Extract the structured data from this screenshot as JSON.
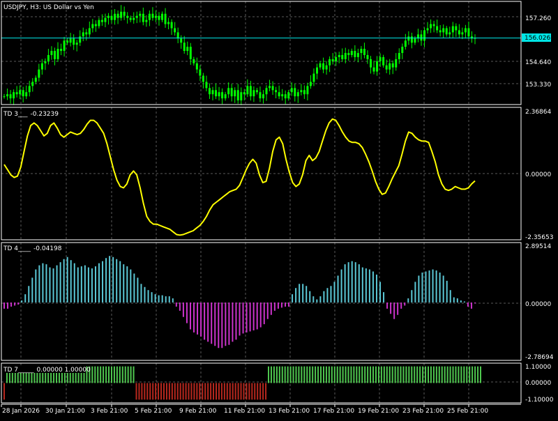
{
  "window": {
    "title": "USDJPY, H3: US Dollar vs Yen"
  },
  "colors": {
    "background": "#000000",
    "grid": "#5a5a5a",
    "frame": "#ffffff",
    "candle": "#00ff00",
    "current_price_line": "#00e5e5",
    "td3_line": "#ffff00",
    "td4_positive": "#5bc8d6",
    "td4_negative": "#cc33cc",
    "td7_positive": "#4fc84f",
    "td7_negative": "#b8281e"
  },
  "panels": {
    "price": {
      "label": "USDJPY, H3: US Dollar vs Yen",
      "current_price": "156.026",
      "axis_labels": [
        "157.260",
        "154.640",
        "153.330"
      ]
    },
    "td3": {
      "label": "TD 3___",
      "value": "-0.23239",
      "axis_labels": [
        "2.36864",
        "0.00000",
        "-2.35653"
      ]
    },
    "td4": {
      "label": "TD 4____",
      "value": "-0.04198",
      "axis_labels": [
        "2.89514",
        "0.00000",
        "-2.78694"
      ]
    },
    "td7": {
      "label": "TD 7_____",
      "value": "0.00000 1.00000",
      "axis_labels": [
        "1.10000",
        "0.00000",
        "-1.10000"
      ]
    }
  },
  "time_axis": {
    "labels": [
      "28 Jan 2026",
      "30 Jan 21:00",
      "3 Feb 21:00",
      "5 Feb 21:00",
      "9 Feb 21:00",
      "11 Feb 21:00",
      "13 Feb 21:00",
      "17 Feb 21:00",
      "19 Feb 21:00",
      "23 Feb 21:00",
      "25 Feb 21:00"
    ]
  },
  "chart_data": [
    {
      "type": "candlestick",
      "title": "USDJPY, H3: US Dollar vs Yen",
      "ylim": [
        152.8,
        157.8
      ],
      "current_price": 156.026,
      "close": [
        153.2,
        153.3,
        153.1,
        153.4,
        153.3,
        153.5,
        153.2,
        153.4,
        153.7,
        153.9,
        154.1,
        154.5,
        154.8,
        154.9,
        155.2,
        155.4,
        155.0,
        155.5,
        155.4,
        155.9,
        155.8,
        156.0,
        155.7,
        155.8,
        156.1,
        156.3,
        156.2,
        156.5,
        156.7,
        156.6,
        156.9,
        156.8,
        157.0,
        157.1,
        156.9,
        157.2,
        157.0,
        157.3,
        157.1,
        157.0,
        156.9,
        157.0,
        157.1,
        157.2,
        156.8,
        156.9,
        157.2,
        157.0,
        157.1,
        156.9,
        157.2,
        156.7,
        156.8,
        156.5,
        156.3,
        156.0,
        155.8,
        155.4,
        155.6,
        155.0,
        154.8,
        154.5,
        154.2,
        153.9,
        153.6,
        153.3,
        153.5,
        153.2,
        153.4,
        153.1,
        153.3,
        153.6,
        153.2,
        153.5,
        153.0,
        153.4,
        153.3,
        153.7,
        153.2,
        153.5,
        153.4,
        153.1,
        153.3,
        153.6,
        153.7,
        153.5,
        153.4,
        153.2,
        153.3,
        153.1,
        153.4,
        153.6,
        153.2,
        153.4,
        153.5,
        153.3,
        153.7,
        153.9,
        154.3,
        154.6,
        154.8,
        154.5,
        154.7,
        155.0,
        154.9,
        155.1,
        155.2,
        155.0,
        155.3,
        155.2,
        155.4,
        155.1,
        155.3,
        155.5,
        155.2,
        155.0,
        154.6,
        154.4,
        154.9,
        155.1,
        154.7,
        154.5,
        154.8,
        154.6,
        155.0,
        155.3,
        155.6,
        155.9,
        156.1,
        155.8,
        156.0,
        156.2,
        155.9,
        156.4,
        156.5,
        156.7,
        156.6,
        156.4,
        156.3,
        156.5,
        156.2,
        156.3,
        156.6,
        156.4,
        156.2,
        156.3,
        156.5,
        156.1,
        156.0,
        156.026
      ],
      "high_offset": 0.28,
      "low_offset": 0.28
    },
    {
      "type": "line",
      "name": "TD 3___",
      "ylim": [
        -2.5,
        2.6
      ],
      "values": [
        0.4,
        0.2,
        0.0,
        -0.1,
        -0.05,
        0.3,
        0.9,
        1.5,
        1.9,
        2.0,
        1.9,
        1.7,
        1.5,
        1.6,
        1.9,
        2.0,
        1.8,
        1.55,
        1.45,
        1.55,
        1.65,
        1.6,
        1.55,
        1.6,
        1.75,
        1.95,
        2.1,
        2.1,
        2.0,
        1.8,
        1.6,
        1.2,
        0.7,
        0.2,
        -0.2,
        -0.45,
        -0.5,
        -0.35,
        0.0,
        0.15,
        0.0,
        -0.5,
        -1.1,
        -1.6,
        -1.8,
        -1.9,
        -1.9,
        -1.95,
        -2.0,
        -2.05,
        -2.1,
        -2.2,
        -2.3,
        -2.32,
        -2.3,
        -2.25,
        -2.2,
        -2.15,
        -2.05,
        -1.95,
        -1.8,
        -1.6,
        -1.35,
        -1.15,
        -1.05,
        -0.95,
        -0.85,
        -0.75,
        -0.65,
        -0.6,
        -0.55,
        -0.4,
        -0.1,
        0.2,
        0.45,
        0.6,
        0.45,
        0.0,
        -0.3,
        -0.25,
        0.25,
        0.9,
        1.35,
        1.45,
        1.2,
        0.6,
        0.1,
        -0.3,
        -0.45,
        -0.35,
        0.0,
        0.55,
        0.75,
        0.55,
        0.65,
        0.9,
        1.3,
        1.7,
        2.0,
        2.15,
        2.1,
        1.9,
        1.65,
        1.45,
        1.3,
        1.25,
        1.25,
        1.2,
        1.05,
        0.8,
        0.5,
        0.15,
        -0.25,
        -0.55,
        -0.75,
        -0.7,
        -0.45,
        -0.15,
        0.1,
        0.35,
        0.8,
        1.3,
        1.65,
        1.6,
        1.45,
        1.35,
        1.3,
        1.3,
        1.25,
        0.9,
        0.5,
        0.0,
        -0.35,
        -0.55,
        -0.6,
        -0.55,
        -0.45,
        -0.5,
        -0.55,
        -0.55,
        -0.5,
        -0.35,
        -0.23239
      ]
    },
    {
      "type": "bar",
      "name": "TD 4____",
      "ylim": [
        -2.8,
        2.9
      ],
      "values": [
        -0.3,
        -0.3,
        -0.2,
        -0.15,
        -0.1,
        0.1,
        0.4,
        0.8,
        1.2,
        1.6,
        1.8,
        1.9,
        1.85,
        1.7,
        1.65,
        1.8,
        1.95,
        2.1,
        2.2,
        2.05,
        1.9,
        1.7,
        1.75,
        1.8,
        1.7,
        1.65,
        1.75,
        1.9,
        2.0,
        2.15,
        2.25,
        2.2,
        2.1,
        2.0,
        1.85,
        1.75,
        1.6,
        1.4,
        1.2,
        0.9,
        0.75,
        0.6,
        0.5,
        0.4,
        0.35,
        0.35,
        0.3,
        0.3,
        0.2,
        -0.2,
        -0.4,
        -0.7,
        -1.0,
        -1.3,
        -1.45,
        -1.55,
        -1.65,
        -1.8,
        -1.9,
        -2.0,
        -2.1,
        -2.2,
        -2.2,
        -2.1,
        -2.05,
        -1.9,
        -1.8,
        -1.6,
        -1.5,
        -1.45,
        -1.4,
        -1.35,
        -1.3,
        -1.2,
        -1.05,
        -0.8,
        -0.6,
        -0.4,
        -0.3,
        -0.25,
        -0.2,
        -0.2,
        0.4,
        0.7,
        0.9,
        0.9,
        0.8,
        0.55,
        0.3,
        0.15,
        0.3,
        0.55,
        0.7,
        0.8,
        1.0,
        1.3,
        1.6,
        1.85,
        1.95,
        2.0,
        1.95,
        1.85,
        1.7,
        1.65,
        1.6,
        1.5,
        1.35,
        1.0,
        0.5,
        -0.3,
        -0.55,
        -0.8,
        -0.6,
        -0.3,
        -0.15,
        0.2,
        0.6,
        1.0,
        1.3,
        1.45,
        1.5,
        1.55,
        1.6,
        1.55,
        1.45,
        1.3,
        1.05,
        0.6,
        0.25,
        0.2,
        0.1,
        0.05,
        -0.2,
        -0.3,
        -0.04198
      ]
    },
    {
      "type": "bar",
      "name": "TD 7_____",
      "ylim": [
        -1.1,
        1.1
      ],
      "values": [
        -1,
        1,
        1,
        1,
        1,
        1,
        1,
        1,
        1,
        1,
        1,
        1,
        1,
        1,
        1,
        1,
        1,
        1,
        1,
        1,
        1,
        1,
        1,
        1,
        1,
        1,
        1,
        1,
        1,
        1,
        1,
        1,
        1,
        1,
        1,
        1,
        1,
        1,
        1,
        1,
        1,
        1,
        1,
        1,
        1,
        1,
        1,
        1,
        -1,
        -1,
        -1,
        -1,
        -1,
        -1,
        -1,
        -1,
        -1,
        -1,
        -1,
        -1,
        -1,
        -1,
        -1,
        -1,
        -1,
        -1,
        -1,
        -1,
        -1,
        -1,
        -1,
        -1,
        -1,
        -1,
        -1,
        -1,
        -1,
        -1,
        -1,
        -1,
        -1,
        -1,
        -1,
        -1,
        -1,
        -1,
        -1,
        -1,
        -1,
        -1,
        -1,
        -1,
        -1,
        -1,
        -1,
        -1,
        1,
        1,
        1,
        1,
        1,
        1,
        1,
        1,
        1,
        1,
        1,
        1,
        1,
        1,
        1,
        1,
        1,
        1,
        1,
        1,
        1,
        1,
        1,
        1,
        1,
        1,
        1,
        1,
        1,
        1,
        1,
        1,
        1,
        1,
        1,
        1,
        1,
        1,
        1,
        1,
        1,
        1,
        1,
        1,
        1,
        1,
        1,
        1,
        1,
        1,
        1,
        1,
        1,
        1,
        1,
        1,
        1,
        1,
        1,
        1,
        1,
        1,
        1,
        1,
        1,
        1,
        1,
        1,
        1,
        1,
        1,
        1,
        1,
        1,
        1,
        1,
        1,
        1
      ]
    }
  ]
}
